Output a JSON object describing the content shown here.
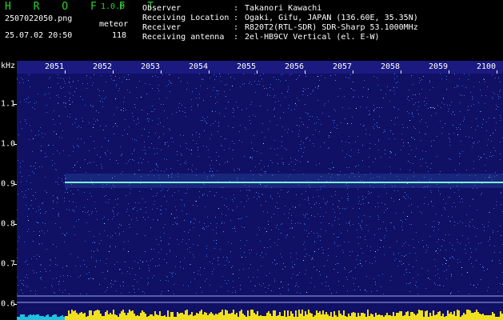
{
  "header": {
    "app_name": "H R O F F T",
    "version": "1.0.0",
    "filename": "2507022050.png",
    "mode": "meteor",
    "datetime": "25.07.02 20:50",
    "count": "118",
    "info": [
      {
        "label": "Observer",
        "value": "Takanori Kawachi"
      },
      {
        "label": "Receiving Location",
        "value": "Ogaki, Gifu, JAPAN (136.60E, 35.35N)"
      },
      {
        "label": "Receiver",
        "value": "R820T2(RTL-SDR) SDR-Sharp 53.1000MHz"
      },
      {
        "label": "Receiving antenna",
        "value": "2el-HB9CV Vertical (el. E-W)"
      }
    ],
    "colon": ":"
  },
  "time_axis": {
    "labels": [
      "2051",
      "2052",
      "2053",
      "2054",
      "2055",
      "2056",
      "2057",
      "2058",
      "2059",
      "2100"
    ]
  },
  "freq_axis": {
    "unit": "kHz",
    "labels": [
      "1.1",
      "1.0",
      "0.9",
      "0.8",
      "0.7",
      "0.6"
    ]
  },
  "colors": {
    "background": "#101065",
    "signal_line": "#7fffd4",
    "noise": "#3a6bd8",
    "logo": "#2fd12f",
    "amplitude": "#f0e020"
  }
}
